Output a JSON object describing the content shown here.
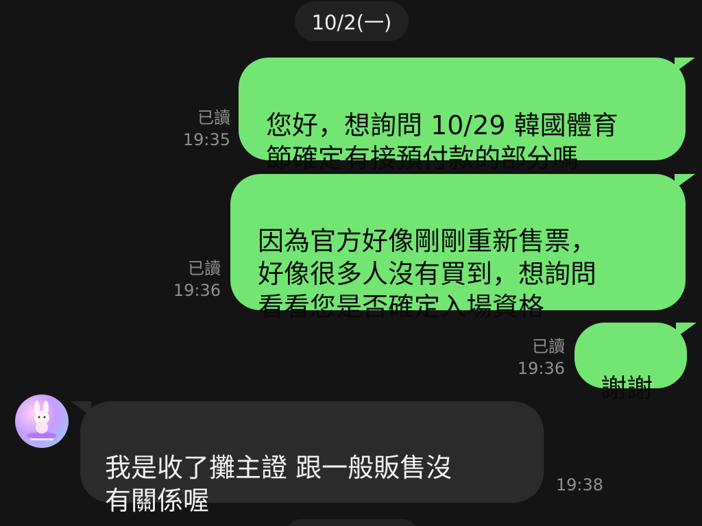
{
  "header": {
    "date_label": "10/2(一)"
  },
  "messages": [
    {
      "direction": "outgoing",
      "text": "您好，想詢問 10/29 韓國體育\n節確定有接預付款的部分嗎",
      "read_label": "已讀",
      "time": "19:35"
    },
    {
      "direction": "outgoing",
      "text": "因為官方好像剛剛重新售票，\n好像很多人沒有買到，想詢問\n看看您是否確定入場資格",
      "read_label": "已讀",
      "time": "19:36"
    },
    {
      "direction": "outgoing",
      "text": "謝謝",
      "read_label": "已讀",
      "time": "19:36"
    },
    {
      "direction": "incoming",
      "text": "我是收了攤主證 跟一般販售沒\n有關係喔",
      "time": "19:38",
      "avatar_icon": "bunny-avatar-icon"
    }
  ],
  "colors": {
    "background": "#141414",
    "outgoing_bubble": "#73e573",
    "incoming_bubble": "#2b2b2b",
    "meta_text": "#8f8f8f",
    "date_pill": "#222222"
  }
}
